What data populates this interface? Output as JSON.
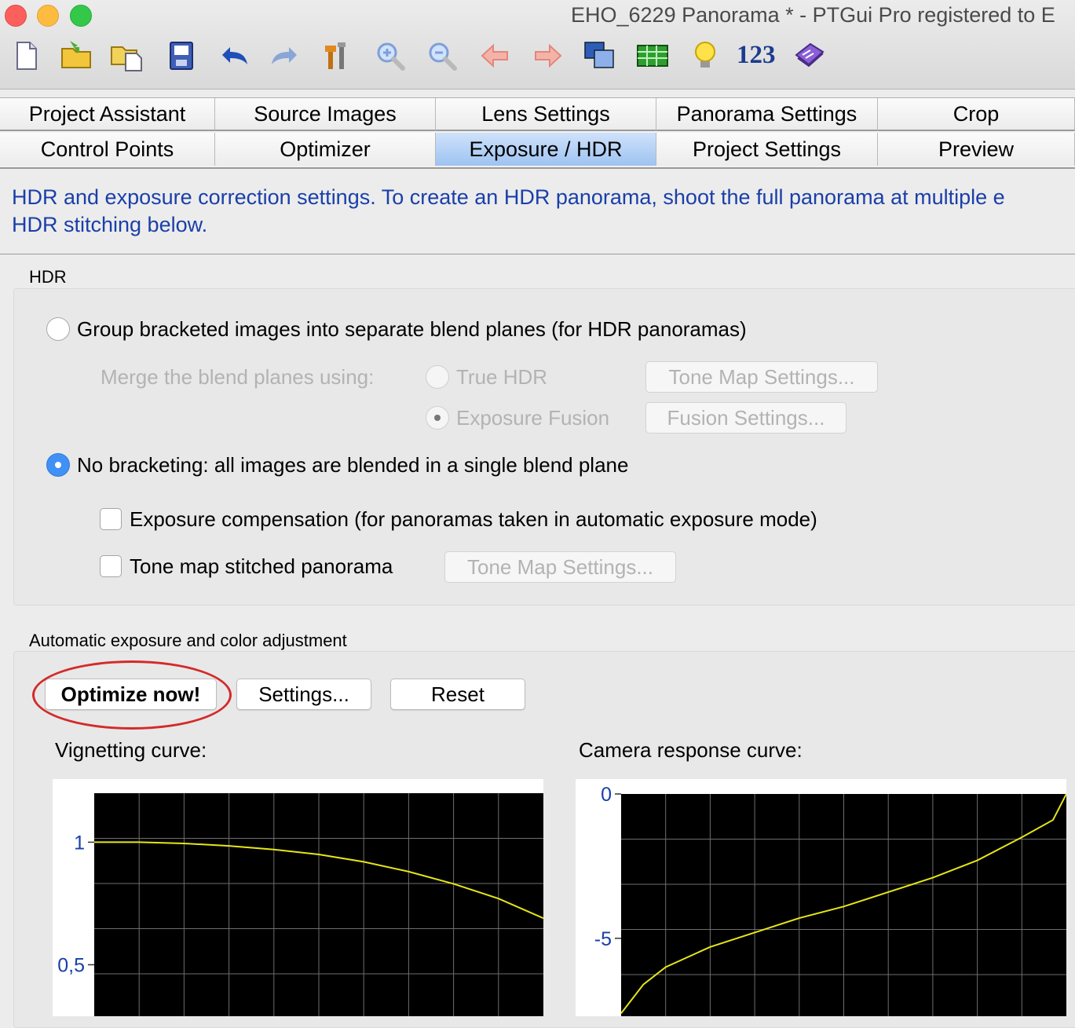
{
  "window": {
    "title": "EHO_6229 Panorama * - PTGui Pro registered to E"
  },
  "toolbar": {
    "icons": [
      "new-document-icon",
      "open-folder-icon",
      "open-recent-icon",
      "save-icon",
      "undo-icon",
      "redo-icon",
      "tools-icon",
      "zoom-in-icon",
      "zoom-out-icon",
      "arrow-left-icon",
      "arrow-right-icon",
      "panorama-editor-icon",
      "table-icon",
      "lightbulb-icon",
      "numbers-icon",
      "help-book-icon"
    ],
    "numbers_label": "123"
  },
  "tabs": {
    "row1": [
      "Project Assistant",
      "Source Images",
      "Lens Settings",
      "Panorama Settings",
      "Crop"
    ],
    "row2": [
      "Control Points",
      "Optimizer",
      "Exposure / HDR",
      "Project Settings",
      "Preview"
    ],
    "active": "Exposure / HDR"
  },
  "description": {
    "line1": "HDR and exposure correction settings. To create an HDR panorama, shoot the full panorama at multiple e",
    "line2": "HDR stitching below."
  },
  "hdr": {
    "title": "HDR",
    "group_option": "Group bracketed images into separate blend planes (for HDR panoramas)",
    "merge_label": "Merge the blend planes using:",
    "true_hdr": "True HDR",
    "exposure_fusion": "Exposure Fusion",
    "tone_map_settings": "Tone Map Settings...",
    "fusion_settings": "Fusion Settings...",
    "no_bracketing": "No bracketing: all images are blended in a single blend plane",
    "exposure_compensation": "Exposure compensation (for panoramas taken in automatic exposure mode)",
    "tone_map_stitched": "Tone map stitched panorama",
    "tone_map_settings_2": "Tone Map Settings..."
  },
  "auto": {
    "title": "Automatic exposure and color adjustment",
    "optimize_now": "Optimize now!",
    "settings": "Settings...",
    "reset": "Reset"
  },
  "colors": {
    "accent": "#3f91f5",
    "description_text": "#1a3fa8",
    "highlight_oval": "#d42a2a",
    "curve": "#e6e619",
    "plot_bg": "#000000"
  },
  "chart_data": [
    {
      "type": "line",
      "title": "Vignetting curve:",
      "ytick_labels": [
        "1",
        "0,5"
      ],
      "yticks": [
        1,
        0.5
      ],
      "ylim_visible": [
        0.29,
        1.2
      ],
      "x": [
        0,
        0.1,
        0.2,
        0.3,
        0.4,
        0.5,
        0.6,
        0.7,
        0.8,
        0.9,
        1.0
      ],
      "y": [
        1.0,
        1.0,
        0.995,
        0.985,
        0.97,
        0.95,
        0.92,
        0.88,
        0.83,
        0.77,
        0.69
      ],
      "grid": true
    },
    {
      "type": "line",
      "title": "Camera response curve:",
      "ytick_labels": [
        "0",
        "-5"
      ],
      "yticks": [
        0,
        -5
      ],
      "ylim_visible": [
        -7.7,
        0
      ],
      "x": [
        0,
        0.05,
        0.1,
        0.2,
        0.3,
        0.4,
        0.5,
        0.6,
        0.7,
        0.8,
        0.9,
        0.97,
        1.0
      ],
      "y": [
        -7.6,
        -6.6,
        -6.0,
        -5.3,
        -4.8,
        -4.3,
        -3.9,
        -3.4,
        -2.9,
        -2.3,
        -1.5,
        -0.9,
        0
      ],
      "grid": true
    }
  ]
}
